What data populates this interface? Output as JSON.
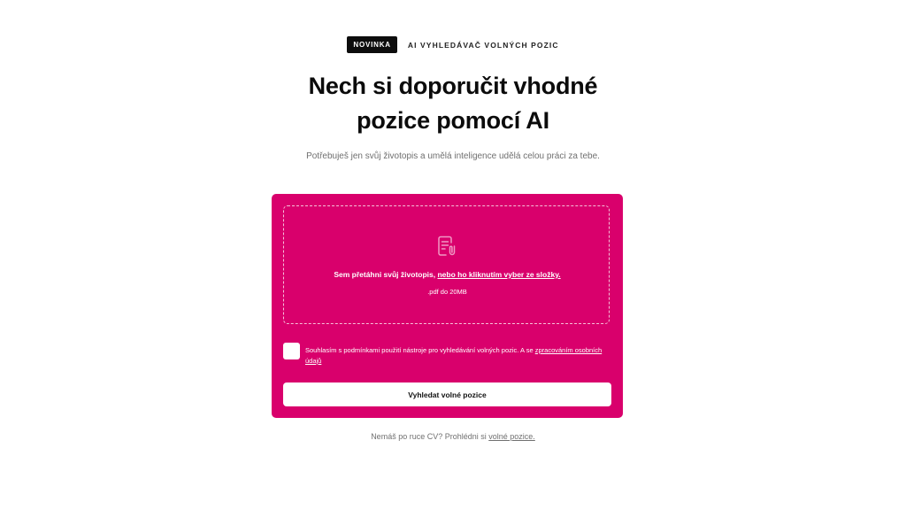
{
  "eyebrow": {
    "badge": "NOVINKA",
    "label": "AI VYHLEDÁVAČ VOLNÝCH POZIC"
  },
  "hero": {
    "title_line1": "Nech si doporučit vhodné",
    "title_line2": "pozice pomocí AI",
    "subtitle": "Potřebuješ jen svůj životopis a umělá inteligence udělá celou práci za tebe."
  },
  "upload": {
    "icon": "document-clip-icon",
    "prompt": "Sem přetáhni svůj životopis, ",
    "prompt_link": "nebo ho kliknutím vyber ze složky.",
    "hint": ".pdf do 20MB"
  },
  "consent": {
    "checked": false,
    "text": "Souhlasím s podmínkami použití nástroje pro vyhledávání volných pozic. A se ",
    "link": "zpracováním osobních údajů"
  },
  "submit": {
    "label": "Vyhledat volné pozice"
  },
  "footer": {
    "text": "Nemáš po ruce CV? Prohlédni si ",
    "link": "volné pozice."
  },
  "colors": {
    "accent": "#d9006c",
    "badge_bg": "#0d0d0d",
    "text_muted": "#6f6f6f"
  }
}
